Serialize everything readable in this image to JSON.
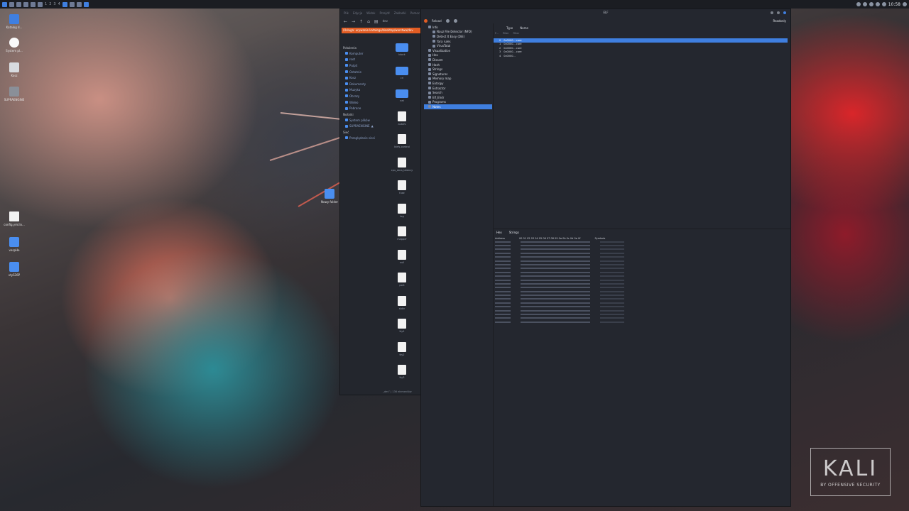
{
  "panel": {
    "workspaces": [
      "1",
      "2",
      "3",
      "4"
    ],
    "clock": "10:58",
    "tray_icons": [
      "network-icon",
      "volume-icon",
      "bell-icon",
      "battery-icon",
      "lock-icon",
      "power-icon"
    ]
  },
  "desktop": {
    "icons": [
      {
        "label": "Katalog d...",
        "type": "home"
      },
      {
        "label": "System pl...",
        "type": "round"
      },
      {
        "label": "Kosz",
        "type": "trash"
      },
      {
        "label": "SUPRAENGINE",
        "type": "drive"
      },
      {
        "label": "config.yml.lo...",
        "type": "file"
      },
      {
        "label": "vespHe",
        "type": "folder"
      },
      {
        "label": "vtyS36P",
        "type": "folder"
      },
      {
        "label": "Nowy folder",
        "type": "folder"
      }
    ]
  },
  "file_manager": {
    "menu": [
      "Plik",
      "Edycja",
      "Widok",
      "Przejdź",
      "Zakładki",
      "Pomoc"
    ],
    "location": "/Usługa: urywanie katalogu/desktop/warstwa/dev",
    "location_label": "dev",
    "sidebar_sections": {
      "places": "Położenia",
      "removable": "Nośniki",
      "network": "Sieć"
    },
    "sidebar_places": [
      "Komputer",
      "root",
      "Pulpit",
      "Ostatnie",
      "Kosz",
      "Dokumenty",
      "Muzyka",
      "Obrazy",
      "Wideo",
      "Pobrane"
    ],
    "sidebar_removable": [
      "System plików",
      "SUPRAENGINE"
    ],
    "sidebar_network": [
      "Przeglądanie sieci"
    ],
    "files": [
      {
        "name": "block",
        "type": "folder"
      },
      {
        "name": "cri",
        "type": "folder"
      },
      {
        "name": "net",
        "type": "folder"
      },
      {
        "name": "autofs",
        "type": "file"
      },
      {
        "name": "btrfs-control",
        "type": "file"
      },
      {
        "name": "cpu_dma_latency",
        "type": "file"
      },
      {
        "name": "fuse",
        "type": "file"
      },
      {
        "name": "log",
        "type": "file"
      },
      {
        "name": "mapper",
        "type": "file"
      },
      {
        "name": "null",
        "type": "file"
      },
      {
        "name": "port",
        "type": "file"
      },
      {
        "name": "stdin",
        "type": "file"
      },
      {
        "name": "tty1",
        "type": "file"
      },
      {
        "name": "tty2",
        "type": "file"
      },
      {
        "name": "tty3",
        "type": "file"
      }
    ],
    "status": "„dev” | 136 elementów"
  },
  "die": {
    "title": "ELF",
    "toolbar": [
      "Reload"
    ],
    "readonly": "Readonly",
    "tree": [
      {
        "label": "Info",
        "selected": false
      },
      {
        "label": "Nauz File Detector (NFD)",
        "selected": false
      },
      {
        "label": "Detect It Easy (DiE)",
        "selected": false
      },
      {
        "label": "Yara rules",
        "selected": false
      },
      {
        "label": "VirusTotal",
        "selected": false
      },
      {
        "label": "Visualization",
        "selected": false
      },
      {
        "label": "Hex",
        "selected": false
      },
      {
        "label": "Disasm",
        "selected": false
      },
      {
        "label": "Hash",
        "selected": false
      },
      {
        "label": "Strings",
        "selected": false
      },
      {
        "label": "Signatures",
        "selected": false
      },
      {
        "label": "Memory map",
        "selected": false
      },
      {
        "label": "Entropy",
        "selected": false
      },
      {
        "label": "Extractor",
        "selected": false
      },
      {
        "label": "Search",
        "selected": false
      },
      {
        "label": "Elf_Ehdr",
        "selected": false
      },
      {
        "label": "Programs",
        "selected": false
      },
      {
        "label": "Notes",
        "selected": true
      }
    ],
    "columns": [
      "Type",
      "Name"
    ],
    "filters": [
      "F...",
      "Filter",
      "Filter"
    ],
    "rows": [
      {
        "n": "0",
        "name": "0x0000... core",
        "selected": true
      },
      {
        "n": "1",
        "name": "0x0000... core",
        "selected": false
      },
      {
        "n": "2",
        "name": "0x0000... core",
        "selected": false
      },
      {
        "n": "3",
        "name": "0x0000... core",
        "selected": false
      },
      {
        "n": "4",
        "name": "0x0000... ",
        "selected": false
      }
    ],
    "tabs": [
      "Hex",
      "Strings"
    ],
    "hex_headers": [
      "Address",
      "00 01 02 03 04 05 06 07 08 09 0a 0b 0c 0d 0e 0f",
      "Symbols"
    ]
  },
  "watermark": {
    "main": "KALI",
    "sub": "BY OFFENSIVE SECURITY"
  }
}
